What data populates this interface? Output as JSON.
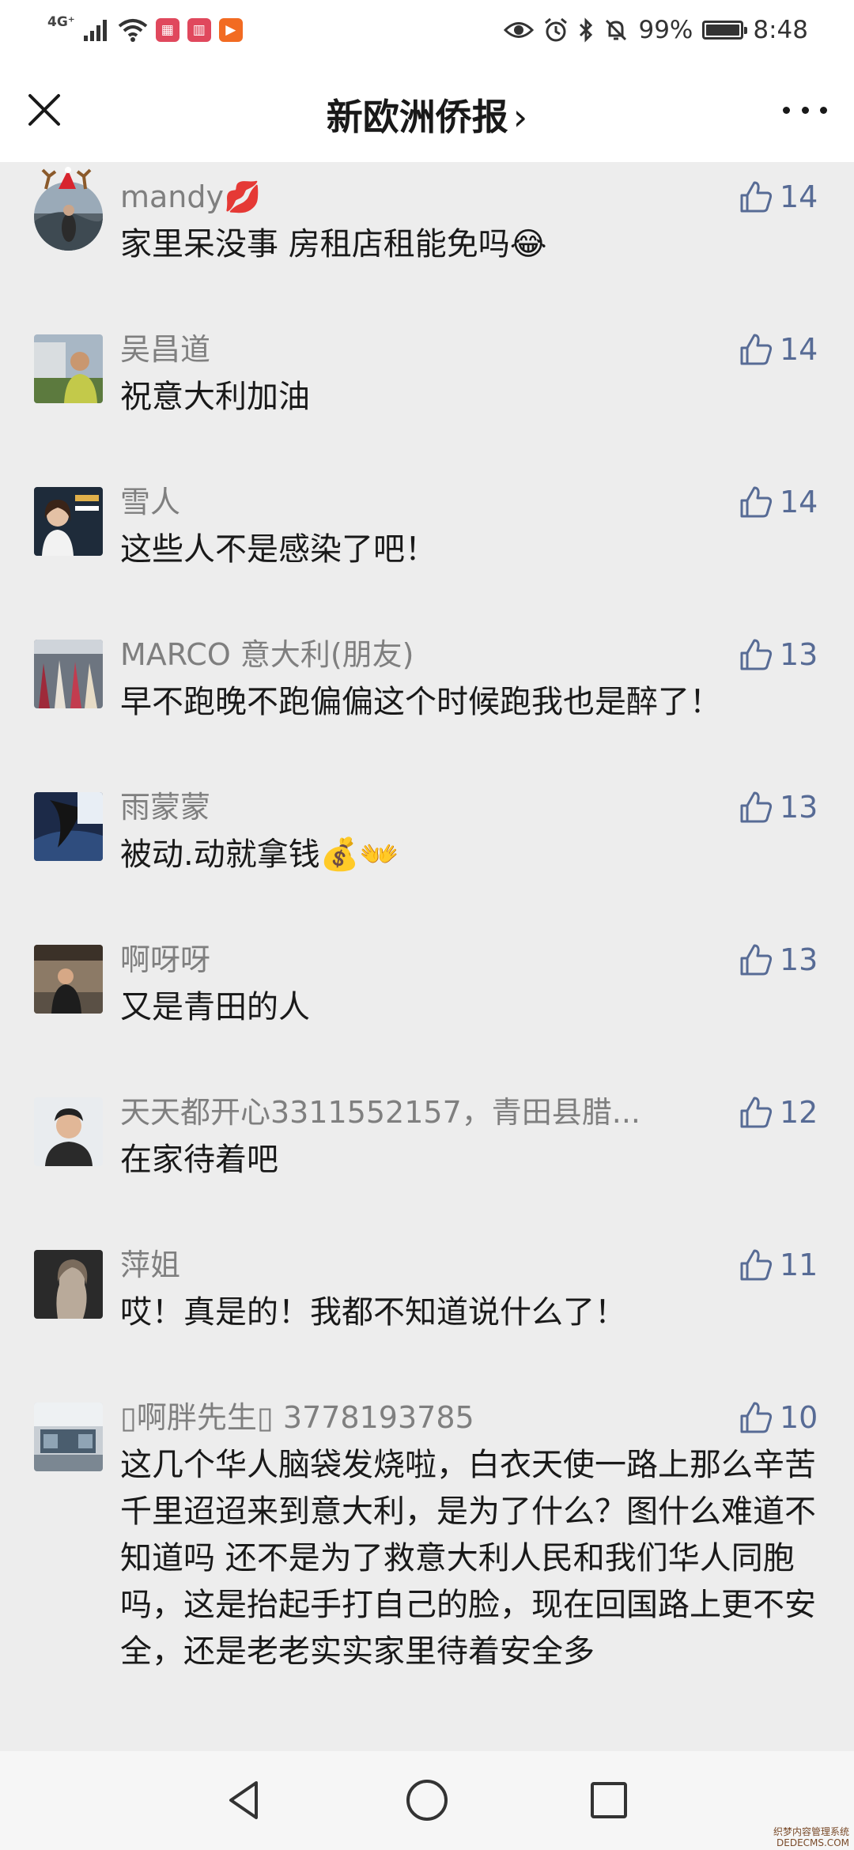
{
  "status_bar": {
    "network": "4G⁺",
    "battery": "99%",
    "battery_level": 0.99,
    "time": "8:48"
  },
  "header": {
    "title": "新欧洲侨报",
    "chevron": "›",
    "icons": {
      "close": "close-icon",
      "more": "more-icon"
    }
  },
  "comments": [
    {
      "name": "mandy💋",
      "text": "家里呆没事 房租店租能免吗😂",
      "likes": "14"
    },
    {
      "name": "吴昌道",
      "text": "祝意大利加油",
      "likes": "14"
    },
    {
      "name": "雪人",
      "text": "这些人不是感染了吧！",
      "likes": "14"
    },
    {
      "name": "MARCO 意大利(朋友)",
      "text": "早不跑晚不跑偏偏这个时候跑我也是醉了！",
      "likes": "13"
    },
    {
      "name": "雨蒙蒙",
      "text": "被动.动就拿钱💰👐",
      "likes": "13"
    },
    {
      "name": "啊呀呀",
      "text": "又是青田的人",
      "likes": "13"
    },
    {
      "name": "天天都开心3311552157，青田县腊...",
      "text": "在家待着吧",
      "likes": "12"
    },
    {
      "name": "萍姐",
      "text": "哎！真是的！我都不知道说什么了！",
      "likes": "11"
    },
    {
      "name": "▯啊胖先生▯ 3778193785",
      "text": "这几个华人脑袋发烧啦，白衣天使一路上那么辛苦 千里迢迢来到意大利，是为了什么？图什么难道不知道吗 还不是为了救意大利人民和我们华人同胞吗，这是抬起手打自己的脸，现在回国路上更不安全，还是老老实实家里待着安全多",
      "likes": "10"
    }
  ],
  "watermark": {
    "line1": "织梦内容管理系统",
    "line2": "DEDECMS.COM"
  }
}
